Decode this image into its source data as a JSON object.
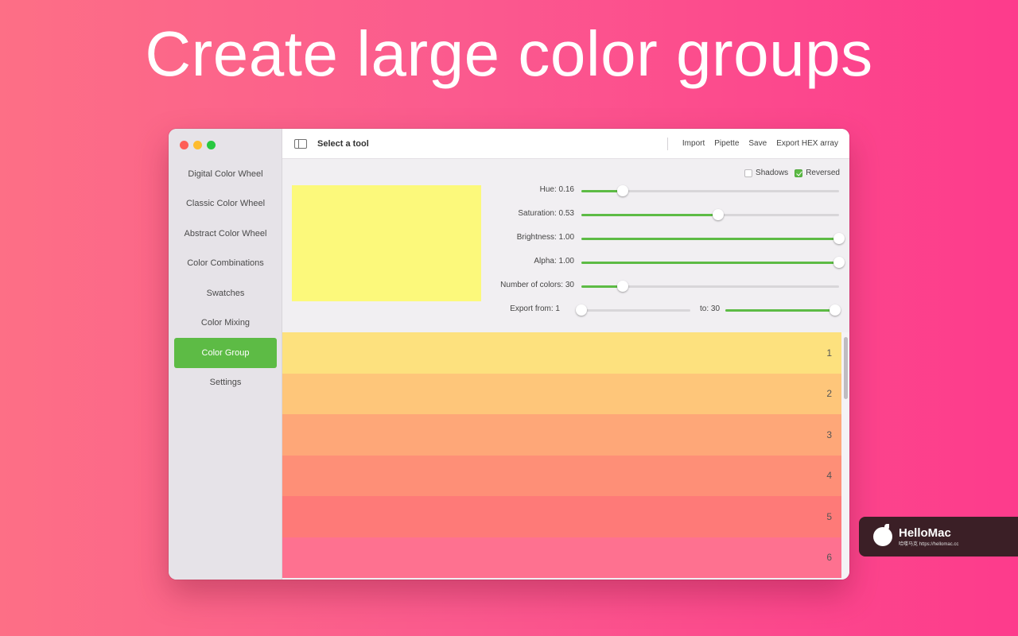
{
  "headline": "Create large color groups",
  "window": {
    "toolbar": {
      "title": "Select a tool",
      "actions": [
        "Import",
        "Pipette",
        "Save",
        "Export HEX array"
      ]
    },
    "sidebar": {
      "items": [
        {
          "label": "Digital Color Wheel",
          "active": false
        },
        {
          "label": "Classic Color Wheel",
          "active": false
        },
        {
          "label": "Abstract Color Wheel",
          "active": false
        },
        {
          "label": "Color Combinations",
          "active": false
        },
        {
          "label": "Swatches",
          "active": false
        },
        {
          "label": "Color Mixing",
          "active": false
        },
        {
          "label": "Color Group",
          "active": true
        },
        {
          "label": "Settings",
          "active": false
        }
      ]
    },
    "options": {
      "shadows": {
        "label": "Shadows",
        "checked": false
      },
      "reversed": {
        "label": "Reversed",
        "checked": true
      }
    },
    "preview_color": "#fcf97b",
    "sliders": [
      {
        "label": "Hue: 0.16",
        "value": 0.16
      },
      {
        "label": "Saturation: 0.53",
        "value": 0.53
      },
      {
        "label": "Brightness: 1.00",
        "value": 1.0
      },
      {
        "label": "Alpha: 1.00",
        "value": 1.0
      },
      {
        "label": "Number of colors: 30",
        "value": 0.16
      }
    ],
    "export": {
      "from_label": "Export from: 1",
      "to_label": "to: 30",
      "from_value": 0.0,
      "to_value": 1.0
    },
    "color_group": [
      {
        "number": "1",
        "color": "#fde17e"
      },
      {
        "number": "2",
        "color": "#fec67a"
      },
      {
        "number": "3",
        "color": "#fea778"
      },
      {
        "number": "4",
        "color": "#fe8f77"
      },
      {
        "number": "5",
        "color": "#fe7a78"
      },
      {
        "number": "6",
        "color": "#fe7190"
      }
    ]
  },
  "watermark": {
    "name": "HelloMac",
    "sub": "哈喽马克 https://hellomac.cc"
  },
  "accent_color": "#5dbb45"
}
